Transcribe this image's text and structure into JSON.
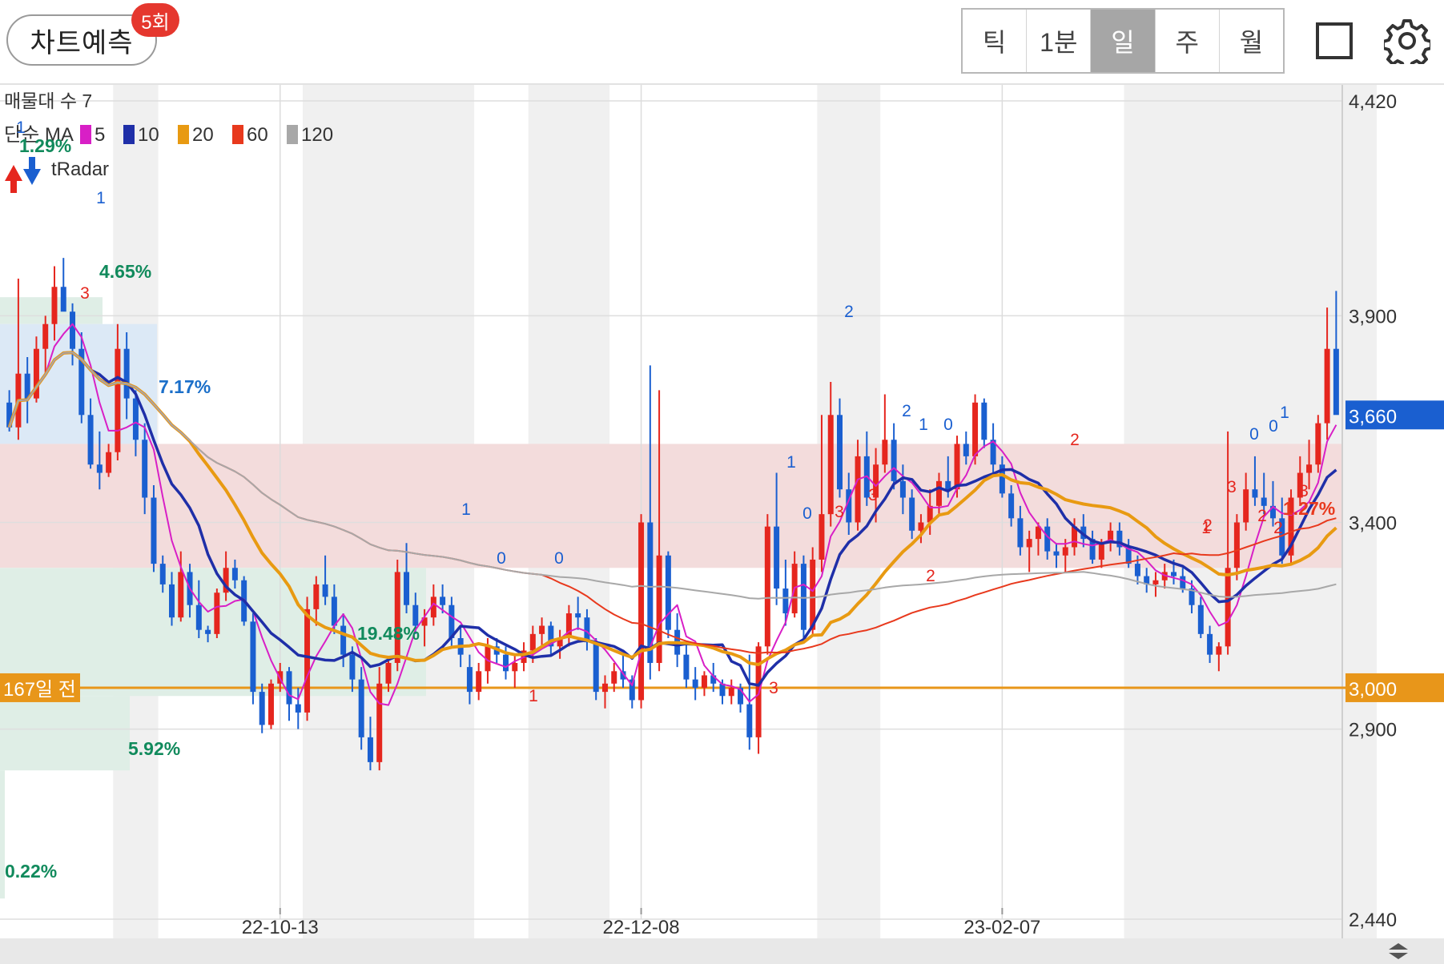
{
  "header": {
    "predict_label": "차트예측",
    "predict_badge": "5회",
    "periods": [
      "틱",
      "1분",
      "일",
      "주",
      "월"
    ],
    "active_period": "일",
    "icons": {
      "layout": "square-icon",
      "settings": "gear-icon"
    }
  },
  "overlays": {
    "volume_profile": "매물대 수 7",
    "ma_prefix": "단순 MA",
    "ma_legend": [
      {
        "period": "5",
        "color": "#d81fc6"
      },
      {
        "period": "10",
        "color": "#1f2fa8"
      },
      {
        "period": "20",
        "color": "#e89a12"
      },
      {
        "period": "60",
        "color": "#e8391d"
      },
      {
        "period": "120",
        "color": "#a8a8a8"
      }
    ],
    "indicator_name": "tRadar",
    "reference_label": "167일 전",
    "reference_value": "3,000",
    "current_price": "3,660",
    "percent_labels": [
      {
        "text": "1.29%",
        "color": "#118a5c"
      },
      {
        "text": "4.65%",
        "color": "#118a5c"
      },
      {
        "text": "7.17%",
        "color": "#1b6fc9"
      },
      {
        "text": "19.48%",
        "color": "#118a5c"
      },
      {
        "text": "5.92%",
        "color": "#118a5c"
      },
      {
        "text": "0.22%",
        "color": "#118a5c"
      },
      {
        "text": "1.27%",
        "color": "#e8391d"
      }
    ],
    "signal_numbers": [
      "1",
      "1",
      "3",
      "1",
      "0",
      "0",
      "1",
      "2",
      "1",
      "0",
      "2",
      "1",
      "2",
      "0",
      "0",
      "2",
      "3",
      "3",
      "3",
      "2",
      "3",
      "1",
      "0",
      "1",
      "2",
      "2",
      "3"
    ]
  },
  "chart_data": {
    "type": "candlestick",
    "y_ticks": [
      4420,
      3900,
      3400,
      2900,
      2440
    ],
    "y_tick_labels": [
      "4,420",
      "3,900",
      "3,400",
      "2,900",
      "2,440"
    ],
    "ylim": [
      2440,
      4420
    ],
    "x_tick_labels": [
      "22-10-13",
      "22-12-08",
      "23-02-07"
    ],
    "x_tick_index": [
      30,
      70,
      110
    ],
    "reference_price": 3000,
    "current_price": 3660,
    "ma_periods": [
      5,
      10,
      20,
      60,
      120
    ],
    "up_color": "#e5261e",
    "down_color": "#1a5fd0",
    "candles": [
      [
        3690,
        3720,
        3620,
        3630
      ],
      [
        3630,
        3990,
        3600,
        3760
      ],
      [
        3760,
        3800,
        3640,
        3700
      ],
      [
        3700,
        3850,
        3690,
        3820
      ],
      [
        3820,
        3900,
        3760,
        3880
      ],
      [
        3880,
        4020,
        3840,
        3970
      ],
      [
        3970,
        4040,
        3920,
        3910
      ],
      [
        3910,
        3930,
        3780,
        3820
      ],
      [
        3820,
        3860,
        3640,
        3660
      ],
      [
        3660,
        3700,
        3530,
        3540
      ],
      [
        3540,
        3620,
        3480,
        3520
      ],
      [
        3520,
        3590,
        3510,
        3570
      ],
      [
        3570,
        3880,
        3550,
        3820
      ],
      [
        3820,
        3860,
        3650,
        3700
      ],
      [
        3700,
        3720,
        3560,
        3600
      ],
      [
        3600,
        3640,
        3420,
        3460
      ],
      [
        3460,
        3490,
        3280,
        3300
      ],
      [
        3300,
        3320,
        3230,
        3250
      ],
      [
        3250,
        3280,
        3150,
        3170
      ],
      [
        3170,
        3330,
        3160,
        3280
      ],
      [
        3280,
        3300,
        3170,
        3200
      ],
      [
        3200,
        3260,
        3120,
        3140
      ],
      [
        3140,
        3150,
        3110,
        3130
      ],
      [
        3130,
        3240,
        3120,
        3230
      ],
      [
        3230,
        3330,
        3210,
        3290
      ],
      [
        3290,
        3310,
        3240,
        3260
      ],
      [
        3260,
        3270,
        3150,
        3160
      ],
      [
        3160,
        3180,
        2960,
        2990
      ],
      [
        2990,
        3010,
        2890,
        2910
      ],
      [
        2910,
        3020,
        2900,
        3010
      ],
      [
        3010,
        3060,
        2990,
        3040
      ],
      [
        3040,
        3050,
        2920,
        2960
      ],
      [
        2960,
        3000,
        2900,
        2940
      ],
      [
        2940,
        3220,
        2920,
        3190
      ],
      [
        3190,
        3270,
        3150,
        3250
      ],
      [
        3250,
        3320,
        3200,
        3220
      ],
      [
        3220,
        3250,
        3130,
        3150
      ],
      [
        3150,
        3180,
        3050,
        3080
      ],
      [
        3080,
        3100,
        2990,
        3020
      ],
      [
        3020,
        3050,
        2850,
        2880
      ],
      [
        2880,
        2930,
        2800,
        2820
      ],
      [
        2820,
        3050,
        2800,
        3010
      ],
      [
        3010,
        3070,
        2990,
        3060
      ],
      [
        3060,
        3310,
        3040,
        3280
      ],
      [
        3280,
        3350,
        3180,
        3200
      ],
      [
        3200,
        3230,
        3130,
        3150
      ],
      [
        3150,
        3190,
        3100,
        3170
      ],
      [
        3170,
        3250,
        3150,
        3220
      ],
      [
        3220,
        3250,
        3180,
        3200
      ],
      [
        3200,
        3220,
        3100,
        3120
      ],
      [
        3120,
        3150,
        3050,
        3080
      ],
      [
        3050,
        3080,
        2960,
        2990
      ],
      [
        2990,
        3060,
        2970,
        3040
      ],
      [
        3040,
        3120,
        3010,
        3100
      ],
      [
        3100,
        3120,
        3060,
        3080
      ],
      [
        3080,
        3100,
        3020,
        3040
      ],
      [
        3040,
        3080,
        3000,
        3060
      ],
      [
        3060,
        3110,
        3040,
        3090
      ],
      [
        3090,
        3150,
        3060,
        3130
      ],
      [
        3130,
        3170,
        3100,
        3150
      ],
      [
        3150,
        3160,
        3080,
        3100
      ],
      [
        3100,
        3140,
        3070,
        3120
      ],
      [
        3120,
        3200,
        3100,
        3180
      ],
      [
        3180,
        3220,
        3140,
        3170
      ],
      [
        3170,
        3190,
        3090,
        3110
      ],
      [
        3110,
        3120,
        2970,
        2990
      ],
      [
        2990,
        3030,
        2950,
        3010
      ],
      [
        3010,
        3060,
        2990,
        3040
      ],
      [
        3040,
        3080,
        3000,
        3020
      ],
      [
        3020,
        3030,
        2950,
        2970
      ],
      [
        2970,
        3420,
        2950,
        3400
      ],
      [
        3400,
        3780,
        3020,
        3060
      ],
      [
        3060,
        3720,
        3040,
        3320
      ],
      [
        3320,
        3330,
        3120,
        3140
      ],
      [
        3140,
        3180,
        3050,
        3080
      ],
      [
        3080,
        3110,
        3000,
        3020
      ],
      [
        3020,
        3050,
        2970,
        3000
      ],
      [
        3000,
        3040,
        2980,
        3030
      ],
      [
        3030,
        3060,
        2990,
        3010
      ],
      [
        3010,
        3020,
        2960,
        2980
      ],
      [
        2980,
        3020,
        2960,
        3000
      ],
      [
        3000,
        3010,
        2940,
        2960
      ],
      [
        2960,
        3080,
        2850,
        2880
      ],
      [
        2880,
        3110,
        2840,
        3100
      ],
      [
        3100,
        3420,
        3080,
        3390
      ],
      [
        3390,
        3520,
        3200,
        3240
      ],
      [
        3240,
        3310,
        3150,
        3180
      ],
      [
        3180,
        3330,
        3170,
        3300
      ],
      [
        3300,
        3320,
        3120,
        3140
      ],
      [
        3140,
        3340,
        3130,
        3310
      ],
      [
        3310,
        3660,
        3280,
        3420
      ],
      [
        3420,
        3740,
        3390,
        3660
      ],
      [
        3660,
        3700,
        3460,
        3480
      ],
      [
        3480,
        3520,
        3370,
        3400
      ],
      [
        3400,
        3600,
        3380,
        3560
      ],
      [
        3560,
        3620,
        3440,
        3460
      ],
      [
        3460,
        3580,
        3400,
        3540
      ],
      [
        3540,
        3710,
        3520,
        3600
      ],
      [
        3600,
        3640,
        3480,
        3500
      ],
      [
        3500,
        3540,
        3420,
        3460
      ],
      [
        3460,
        3480,
        3360,
        3380
      ],
      [
        3380,
        3420,
        3350,
        3400
      ],
      [
        3400,
        3480,
        3370,
        3440
      ],
      [
        3440,
        3520,
        3420,
        3500
      ],
      [
        3500,
        3560,
        3460,
        3480
      ],
      [
        3480,
        3610,
        3460,
        3590
      ],
      [
        3590,
        3620,
        3540,
        3560
      ],
      [
        3560,
        3710,
        3540,
        3690
      ],
      [
        3690,
        3700,
        3580,
        3600
      ],
      [
        3600,
        3640,
        3520,
        3540
      ],
      [
        3540,
        3560,
        3460,
        3470
      ],
      [
        3470,
        3490,
        3390,
        3410
      ],
      [
        3410,
        3440,
        3320,
        3340
      ],
      [
        3340,
        3380,
        3280,
        3360
      ],
      [
        3360,
        3400,
        3320,
        3390
      ],
      [
        3390,
        3410,
        3310,
        3330
      ],
      [
        3330,
        3350,
        3290,
        3320
      ],
      [
        3320,
        3360,
        3280,
        3340
      ],
      [
        3340,
        3410,
        3320,
        3390
      ],
      [
        3390,
        3420,
        3340,
        3360
      ],
      [
        3360,
        3380,
        3300,
        3310
      ],
      [
        3310,
        3360,
        3290,
        3350
      ],
      [
        3350,
        3400,
        3330,
        3380
      ],
      [
        3380,
        3400,
        3320,
        3340
      ],
      [
        3340,
        3360,
        3290,
        3300
      ],
      [
        3300,
        3320,
        3250,
        3270
      ],
      [
        3270,
        3290,
        3230,
        3250
      ],
      [
        3250,
        3280,
        3220,
        3260
      ],
      [
        3260,
        3300,
        3240,
        3280
      ],
      [
        3280,
        3310,
        3250,
        3270
      ],
      [
        3270,
        3290,
        3230,
        3240
      ],
      [
        3240,
        3260,
        3180,
        3200
      ],
      [
        3200,
        3220,
        3120,
        3130
      ],
      [
        3130,
        3150,
        3060,
        3080
      ],
      [
        3080,
        3110,
        3040,
        3100
      ],
      [
        3100,
        3620,
        3080,
        3290
      ],
      [
        3290,
        3420,
        3260,
        3400
      ],
      [
        3400,
        3520,
        3380,
        3480
      ],
      [
        3480,
        3560,
        3440,
        3460
      ],
      [
        3460,
        3520,
        3420,
        3440
      ],
      [
        3440,
        3500,
        3390,
        3410
      ],
      [
        3410,
        3460,
        3300,
        3320
      ],
      [
        3320,
        3480,
        3300,
        3460
      ],
      [
        3460,
        3560,
        3440,
        3520
      ],
      [
        3520,
        3600,
        3480,
        3540
      ],
      [
        3540,
        3660,
        3520,
        3640
      ],
      [
        3640,
        3920,
        3600,
        3820
      ],
      [
        3820,
        3960,
        3700,
        3660
      ]
    ]
  }
}
